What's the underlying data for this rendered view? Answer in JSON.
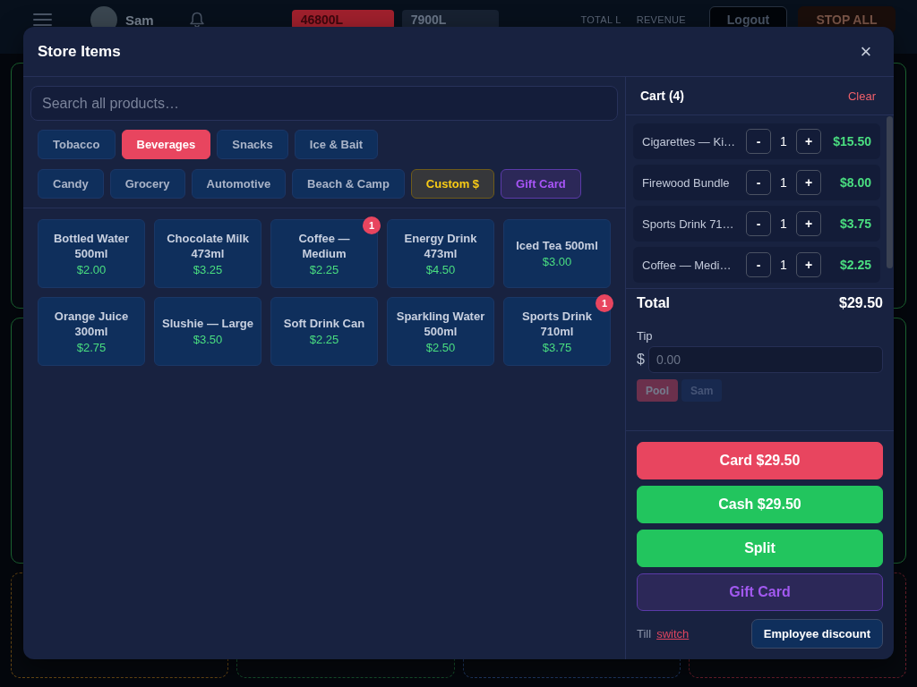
{
  "background": {
    "header": {
      "user_name": "Sam",
      "chips": [
        {
          "label": "46800L",
          "kind": "alert"
        },
        {
          "label": "7900L",
          "kind": "plain"
        }
      ],
      "stats": [
        "TOTAL L",
        "REVENUE"
      ],
      "buttons": [
        {
          "label": "Logout",
          "kind": "logout"
        },
        {
          "label": "STOP ALL",
          "kind": "stop"
        }
      ]
    },
    "tiles": [
      {
        "color": "#6b4a14"
      },
      {
        "color": "#16532e"
      },
      {
        "color": "#1f3a66"
      },
      {
        "color": "#6b1e2b"
      }
    ]
  },
  "modal": {
    "title": "Store Items",
    "close": "×",
    "search": {
      "placeholder": "Search all products…"
    },
    "category_rows": [
      [
        {
          "label": "Tobacco",
          "kind": "category",
          "selected": false
        },
        {
          "label": "Beverages",
          "kind": "category",
          "selected": true
        },
        {
          "label": "Snacks",
          "kind": "category",
          "selected": false
        },
        {
          "label": "Ice & Bait",
          "kind": "category",
          "selected": false
        }
      ],
      [
        {
          "label": "Candy",
          "kind": "category",
          "selected": false
        },
        {
          "label": "Grocery",
          "kind": "category",
          "selected": false
        },
        {
          "label": "Automotive",
          "kind": "category",
          "selected": false
        },
        {
          "label": "Beach & Camp",
          "kind": "category",
          "selected": false
        },
        {
          "label": "Custom $",
          "kind": "custom",
          "selected": false
        },
        {
          "label": "Gift Card",
          "kind": "gift",
          "selected": false
        }
      ]
    ],
    "products": [
      {
        "name": "Bottled Water 500ml",
        "price": "$2.00"
      },
      {
        "name": "Chocolate Milk 473ml",
        "price": "$3.25"
      },
      {
        "name": "Coffee — Medium",
        "price": "$2.25",
        "badge": "1"
      },
      {
        "name": "Energy Drink 473ml",
        "price": "$4.50"
      },
      {
        "name": "Iced Tea 500ml",
        "price": "$3.00"
      },
      {
        "name": "Orange Juice 300ml",
        "price": "$2.75"
      },
      {
        "name": "Slushie — Large",
        "price": "$3.50"
      },
      {
        "name": "Soft Drink Can",
        "price": "$2.25"
      },
      {
        "name": "Sparkling Water 500ml",
        "price": "$2.50"
      },
      {
        "name": "Sports Drink 710ml",
        "price": "$3.75",
        "badge": "1"
      }
    ],
    "cart": {
      "title": "Cart (4)",
      "clear": "Clear",
      "items": [
        {
          "name": "Cigarettes — Ki…",
          "minus": "-",
          "qty": "1",
          "plus": "+",
          "price": "$15.50"
        },
        {
          "name": "Firewood Bundle",
          "minus": "-",
          "qty": "1",
          "plus": "+",
          "price": "$8.00"
        },
        {
          "name": "Sports Drink 71…",
          "minus": "-",
          "qty": "1",
          "plus": "+",
          "price": "$3.75"
        },
        {
          "name": "Coffee — Medi…",
          "minus": "-",
          "qty": "1",
          "plus": "+",
          "price": "$2.25"
        }
      ]
    },
    "total": {
      "label": "Total",
      "value": "$29.50"
    },
    "tip": {
      "label": "Tip",
      "currency": "$",
      "placeholder": "0.00",
      "disabled": true,
      "targets": [
        {
          "label": "Pool",
          "selected": true
        },
        {
          "label": "Sam",
          "selected": false
        }
      ]
    },
    "payments": [
      {
        "label": "Card $29.50",
        "kind": "card"
      },
      {
        "label": "Cash $29.50",
        "kind": "cash"
      },
      {
        "label": "Split",
        "kind": "split"
      },
      {
        "label": "Gift Card",
        "kind": "gift"
      }
    ],
    "footer": {
      "till_label": "Till",
      "switch_link": "switch",
      "discount_button": "Employee discount"
    }
  }
}
